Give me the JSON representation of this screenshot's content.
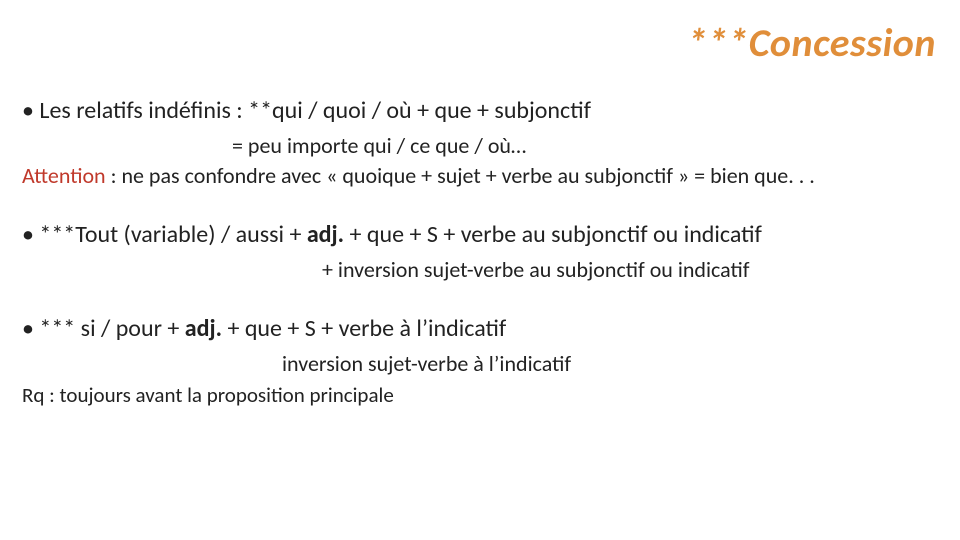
{
  "title": "***Concession",
  "bullets": [
    {
      "main": "Les relatifs indéfinis : **qui / quoi / où   + que + subjonctif",
      "sub1": "= peu importe qui / ce que / où…",
      "warn_prefix": "Attention",
      "warn_rest": " : ne pas confondre avec « quoique + sujet + verbe au subjonctif » = bien que. . ."
    },
    {
      "main_pre": "***Tout (variable) / aussi + ",
      "main_adj": "adj.",
      "main_post": " + que + S + verbe au subjonctif ou indicatif",
      "line2": "+  inversion sujet-verbe au subjonctif ou indicatif"
    },
    {
      "main_pre": "*** si / pour  + ",
      "main_adj": "adj.",
      "main_post": " + que + S + verbe à l’indicatif",
      "line2": "inversion sujet-verbe à l’indicatif",
      "note": "Rq : toujours avant la proposition principale"
    }
  ]
}
